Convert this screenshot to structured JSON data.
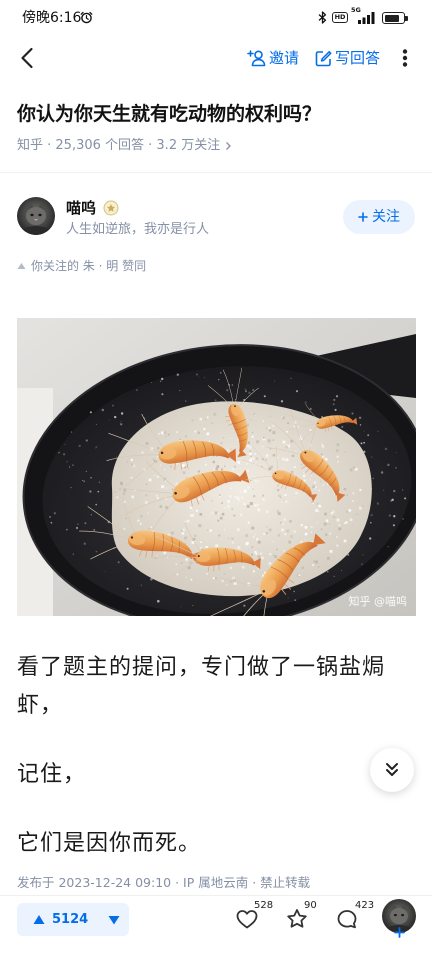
{
  "status_bar": {
    "time": "傍晚6:16",
    "hd_label": "HD",
    "network_label": "5G",
    "icons": [
      "alarm-icon",
      "bluetooth-icon",
      "hd-icon",
      "signal-icon",
      "battery-icon"
    ]
  },
  "nav": {
    "back_icon": "chevron-left-icon",
    "invite": {
      "icon": "invite-icon",
      "label": "邀请"
    },
    "write_answer": {
      "icon": "edit-icon",
      "label": "写回答"
    },
    "more_icon": "more-vertical-icon"
  },
  "question": {
    "title": "你认为你天生就有吃动物的权利吗？",
    "meta": "知乎 · 25,306 个回答 · 3.2 万关注",
    "meta_icon": "chevron-right-icon"
  },
  "author": {
    "name": "喵呜",
    "badge_icon": "badge-icon",
    "bio": "人生如逆旅，我亦是行人",
    "follow_label": "关注",
    "follow_icon": "plus-icon"
  },
  "endorsement": "你关注的 朱 · 明 赞同",
  "answer": {
    "image_watermark": "知乎 @喵呜",
    "paragraphs": [
      "看了题主的提问，专门做了一锅盐焗虾，",
      "记住，",
      "它们是因你而死。"
    ],
    "published": "发布于 2023-12-24 09:10 · IP 属地云南 · 禁止转载",
    "scroll_icon": "double-chevron-down-icon"
  },
  "actions": {
    "vote_count": "5124",
    "like_count": "528",
    "favorite_count": "90",
    "comment_count": "423",
    "icons": [
      "upvote-icon",
      "downvote-icon",
      "heart-icon",
      "star-icon",
      "comment-icon",
      "avatar",
      "plus-icon"
    ]
  },
  "colors": {
    "accent": "#056DE8",
    "text": "#121212",
    "muted": "#8590A6",
    "pill_bg": "#EBF3FE"
  }
}
